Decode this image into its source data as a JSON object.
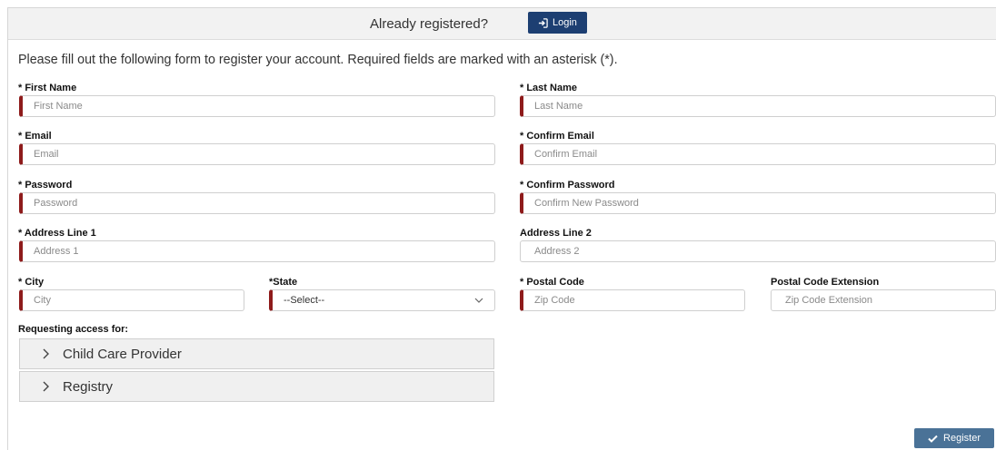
{
  "topbar": {
    "question": "Already registered?",
    "login_label": "Login"
  },
  "intro": "Please fill out the following form to register your account. Required fields are marked with an asterisk (*).",
  "fields": {
    "first_name": {
      "label": "* First Name",
      "placeholder": "First Name"
    },
    "last_name": {
      "label": "* Last Name",
      "placeholder": "Last Name"
    },
    "email": {
      "label": "* Email",
      "placeholder": "Email"
    },
    "confirm_email": {
      "label": "* Confirm Email",
      "placeholder": "Confirm Email"
    },
    "password": {
      "label": "* Password",
      "placeholder": "Password"
    },
    "confirm_password": {
      "label": "* Confirm Password",
      "placeholder": "Confirm New Password"
    },
    "address1": {
      "label": "* Address Line 1",
      "placeholder": "Address 1"
    },
    "address2": {
      "label": "Address Line 2",
      "placeholder": "Address 2"
    },
    "city": {
      "label": "* City",
      "placeholder": "City"
    },
    "state": {
      "label": "*State",
      "value": "--Select--"
    },
    "postal_code": {
      "label": "* Postal Code",
      "placeholder": "Zip Code"
    },
    "postal_ext": {
      "label": "Postal Code Extension",
      "placeholder": "Zip Code Extension"
    }
  },
  "access": {
    "label": "Requesting access for:",
    "panels": [
      "Child Care Provider",
      "Registry"
    ]
  },
  "register_label": "Register",
  "colors": {
    "required_marker": "#8e1b1b",
    "login_button": "#1d3f72",
    "register_button": "#4a7297"
  }
}
